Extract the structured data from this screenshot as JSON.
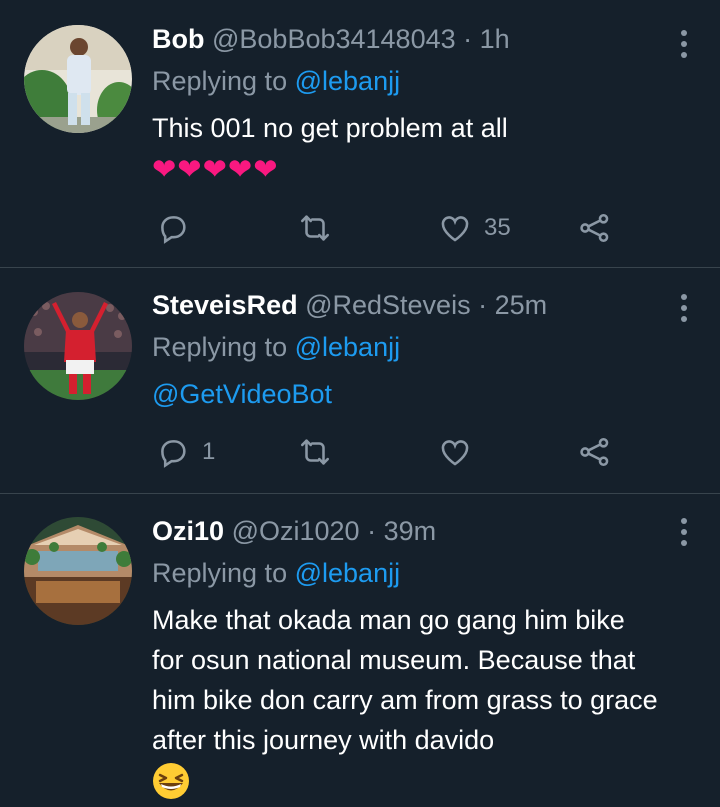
{
  "tweets": [
    {
      "name": "Bob",
      "handle": "@BobBob34148043",
      "separator": "·",
      "time": "1h",
      "replying_prefix": "Replying to",
      "replying_to": "@lebanjj",
      "text": "This 001 no get problem at all",
      "hearts": "❤❤❤❤❤",
      "reply_count": "",
      "like_count": "35"
    },
    {
      "name": "SteveisRed",
      "handle": "@RedSteveis",
      "separator": "·",
      "time": "25m",
      "replying_prefix": "Replying to",
      "replying_to": "@lebanjj",
      "text": "@GetVideoBot",
      "reply_count": "1",
      "like_count": ""
    },
    {
      "name": "Ozi10",
      "handle": "@Ozi1020",
      "separator": "·",
      "time": "39m",
      "replying_prefix": "Replying to",
      "replying_to": "@lebanjj",
      "text": "Make that okada man go gang him bike for osun national museum. Because that him bike don carry am from grass to grace after this journey with davido",
      "emoji": "grinning-squinting-face-emoji"
    }
  ],
  "icons": {
    "reply": "reply-icon",
    "retweet": "retweet-icon",
    "like": "like-icon",
    "share": "share-icon",
    "more": "more-options-icon"
  },
  "colors": {
    "background": "#15202b",
    "divider": "#38444d",
    "secondary_text": "#8b98a5",
    "link": "#1d9bf0",
    "heart": "#f91880"
  }
}
